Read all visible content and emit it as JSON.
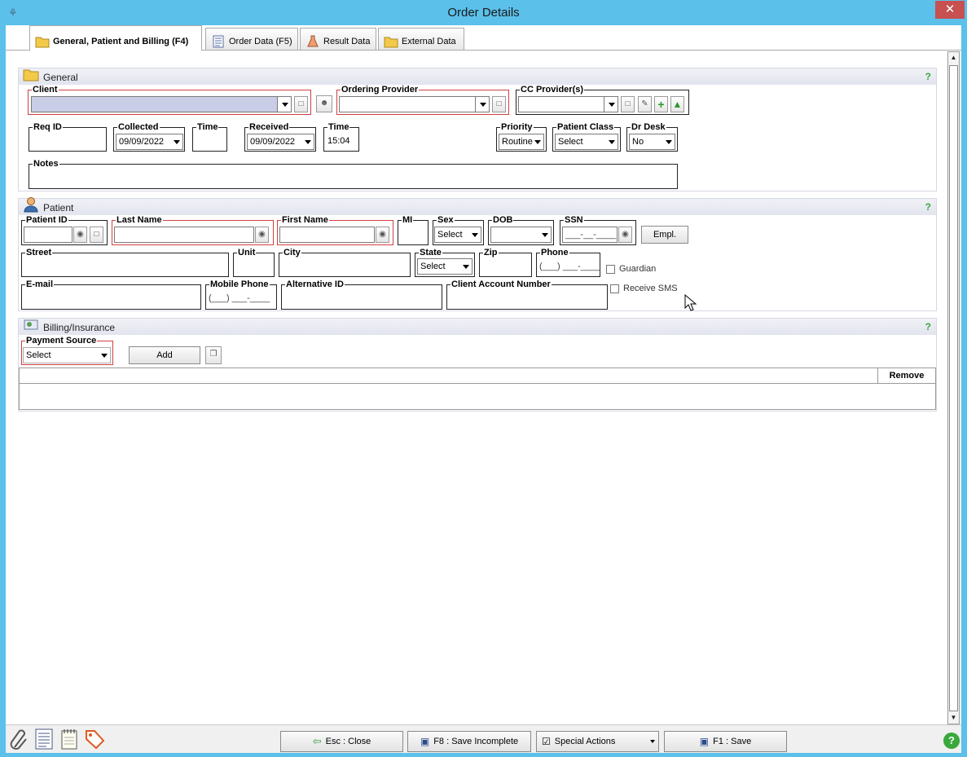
{
  "window": {
    "title": "Order Details",
    "app_icon": "app-icon",
    "close_symbol": "✕"
  },
  "tabs": [
    {
      "label": "General, Patient and Billing (F4)",
      "icon": "folder-icon",
      "active": true
    },
    {
      "label": "Order Data (F5)",
      "icon": "list-document-icon",
      "active": false
    },
    {
      "label": "Result Data",
      "icon": "flask-icon",
      "active": false
    },
    {
      "label": "External Data",
      "icon": "folder-icon",
      "active": false
    }
  ],
  "general": {
    "title": "General",
    "help": "?",
    "client_label": "Client",
    "client_value": "",
    "ordering_provider_label": "Ordering Provider",
    "ordering_provider_value": "",
    "cc_provider_label": "CC Provider(s)",
    "cc_provider_value": "",
    "req_id_label": "Req ID",
    "req_id_value": "",
    "collected_label": "Collected",
    "collected_value": "09/09/2022",
    "time1_label": "Time",
    "time1_value": "",
    "received_label": "Received",
    "received_value": "09/09/2022",
    "time2_label": "Time",
    "time2_value": "15:04",
    "priority_label": "Priority",
    "priority_value": "Routine",
    "patient_class_label": "Patient Class",
    "patient_class_value": "Select",
    "dr_desk_label": "Dr Desk",
    "dr_desk_value": "No",
    "notes_label": "Notes",
    "notes_value": ""
  },
  "patient": {
    "title": "Patient",
    "help": "?",
    "patient_id_label": "Patient ID",
    "last_name_label": "Last Name",
    "first_name_label": "First Name",
    "mi_label": "MI",
    "sex_label": "Sex",
    "sex_value": "Select",
    "dob_label": "DOB",
    "ssn_label": "SSN",
    "ssn_mask": "___-__-____",
    "empl_button": "Empl.",
    "street_label": "Street",
    "unit_label": "Unit",
    "city_label": "City",
    "state_label": "State",
    "state_value": "Select",
    "zip_label": "Zip",
    "phone_label": "Phone",
    "phone_mask": "(___) ___-____",
    "guardian_label": "Guardian",
    "email_label": "E-mail",
    "mobile_phone_label": "Mobile Phone",
    "mobile_phone_mask": "(___) ___-____",
    "alternative_id_label": "Alternative ID",
    "client_account_number_label": "Client Account Number",
    "receive_sms_label": "Receive SMS"
  },
  "billing": {
    "title": "Billing/Insurance",
    "help": "?",
    "payment_source_label": "Payment Source",
    "payment_source_value": "Select",
    "add_button": "Add",
    "table_remove_header": "Remove"
  },
  "footer": {
    "close_button": "Esc : Close",
    "save_incomplete_button": "F8 : Save Incomplete",
    "special_actions_button": "Special Actions",
    "save_button": "F1 : Save",
    "help": "?"
  },
  "colors": {
    "titlebar": "#5bc0ea",
    "required_border": "#d04040",
    "close": "#c75050",
    "help_green": "#3aa83a"
  }
}
